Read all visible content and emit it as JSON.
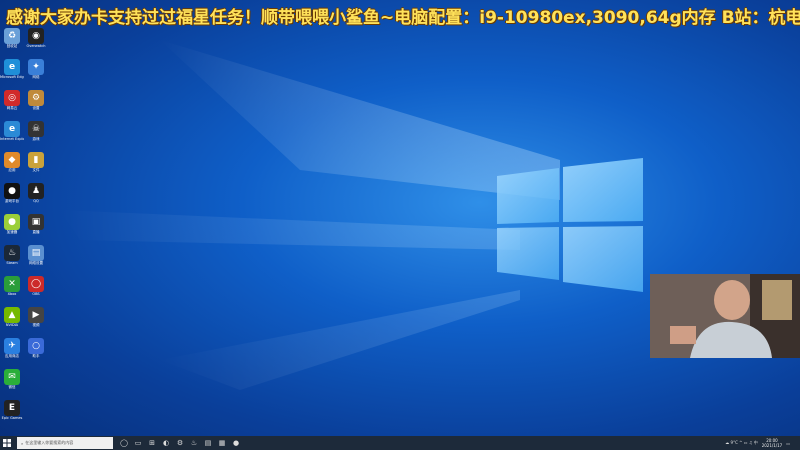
{
  "overlay": {
    "banner_text": "感谢大家办卡支持过过福星任务！顺带喂喂小鲨鱼~电脑配置：i9-10980ex,3090,64g内存 B站：杭电光头学长"
  },
  "desktop": {
    "icons": [
      {
        "label": "回收站",
        "glyph": "♻",
        "color": "#6aa0d8",
        "col": 0,
        "row": 0
      },
      {
        "label": "Overwatch",
        "glyph": "◉",
        "color": "#222222",
        "col": 1,
        "row": 0
      },
      {
        "label": "Microsoft Edge",
        "glyph": "e",
        "color": "#1f8fd9",
        "col": 0,
        "row": 1
      },
      {
        "label": "网络",
        "glyph": "✦",
        "color": "#3a7fd8",
        "col": 1,
        "row": 1
      },
      {
        "label": "网易云",
        "glyph": "◎",
        "color": "#d12a2a",
        "col": 0,
        "row": 2
      },
      {
        "label": "设置",
        "glyph": "⚙",
        "color": "#c08a3a",
        "col": 1,
        "row": 2
      },
      {
        "label": "Internet Explorer",
        "glyph": "e",
        "color": "#2b8ad6",
        "col": 0,
        "row": 3
      },
      {
        "label": "游戏",
        "glyph": "☠",
        "color": "#333333",
        "col": 1,
        "row": 3
      },
      {
        "label": "应用",
        "glyph": "◆",
        "color": "#e08a2a",
        "col": 0,
        "row": 4
      },
      {
        "label": "文件",
        "glyph": "▮",
        "color": "#caa23a",
        "col": 1,
        "row": 4
      },
      {
        "label": "游戏平台",
        "glyph": "●",
        "color": "#111111",
        "col": 0,
        "row": 5
      },
      {
        "label": "QQ",
        "glyph": "♟",
        "color": "#222222",
        "col": 1,
        "row": 5
      },
      {
        "label": "加速器",
        "glyph": "●",
        "color": "#9bcf3a",
        "col": 0,
        "row": 6
      },
      {
        "label": "直播",
        "glyph": "▣",
        "color": "#333333",
        "col": 1,
        "row": 6
      },
      {
        "label": "Steam",
        "glyph": "♨",
        "color": "#1b2838",
        "col": 0,
        "row": 7
      },
      {
        "label": "网络设置",
        "glyph": "▤",
        "color": "#5a8fd0",
        "col": 1,
        "row": 7
      },
      {
        "label": "Xbox",
        "glyph": "✕",
        "color": "#2a9d3a",
        "col": 0,
        "row": 8
      },
      {
        "label": "OBS",
        "glyph": "◯",
        "color": "#cc2a2a",
        "col": 1,
        "row": 8
      },
      {
        "label": "NVIDIA",
        "glyph": "▲",
        "color": "#76b900",
        "col": 0,
        "row": 9
      },
      {
        "label": "视频",
        "glyph": "▶",
        "color": "#444444",
        "col": 1,
        "row": 9
      },
      {
        "label": "应用商店",
        "glyph": "✈",
        "color": "#2a7fe0",
        "col": 0,
        "row": 10
      },
      {
        "label": "助手",
        "glyph": "○",
        "color": "#3a6ad8",
        "col": 1,
        "row": 10
      },
      {
        "label": "微信",
        "glyph": "✉",
        "color": "#2aae3a",
        "col": 0,
        "row": 11
      },
      {
        "label": "Epic Games",
        "glyph": "E",
        "color": "#222222",
        "col": 0,
        "row": 12
      }
    ]
  },
  "taskbar": {
    "search_placeholder": "在这里输入你要搜索的内容",
    "apps": [
      "◯",
      "▭",
      "⊞",
      "◐",
      "⚙",
      "♨",
      "▤",
      "▦",
      "●"
    ],
    "tray_text": "☁ 9°C  ^  ▭  ♫  中",
    "time": "20:00",
    "date": "2021/1/17"
  },
  "colors": {
    "banner": "#ffe25a",
    "taskbar": "#1d2a3a",
    "accent": "#1f8fd9"
  }
}
